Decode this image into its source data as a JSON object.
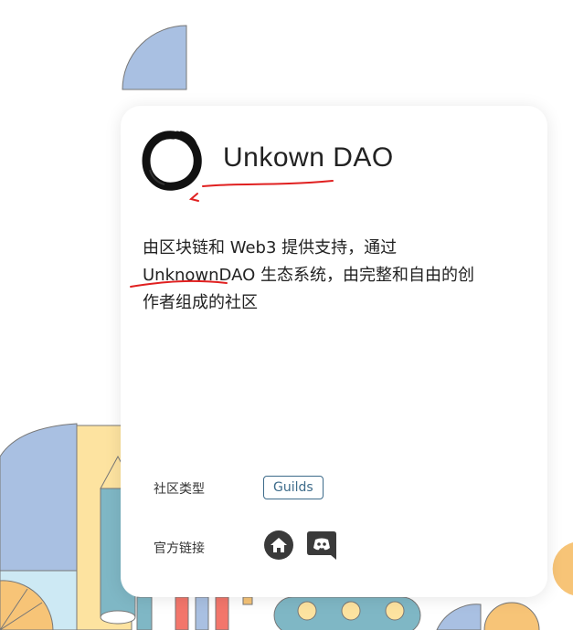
{
  "dao": {
    "name": "Unkown DAO",
    "description_lines": [
      "由区块链和 Web3 提供支持，通过",
      "UnknownDAO 生态系统，由完整和自由的创",
      "作者组成的社区"
    ]
  },
  "meta": {
    "type_label": "社区类型",
    "type_tag": "Guilds",
    "links_label": "官方链接",
    "links": [
      {
        "icon": "home-icon"
      },
      {
        "icon": "discord-icon"
      }
    ]
  },
  "colors": {
    "accent": "#3d6b8a",
    "annotation": "#e02020",
    "deco_blue": "#a9c0e2",
    "deco_yellow": "#fde3a0",
    "deco_teal": "#7fb7c5",
    "deco_orange": "#f7c477",
    "deco_red": "#f3766b"
  }
}
